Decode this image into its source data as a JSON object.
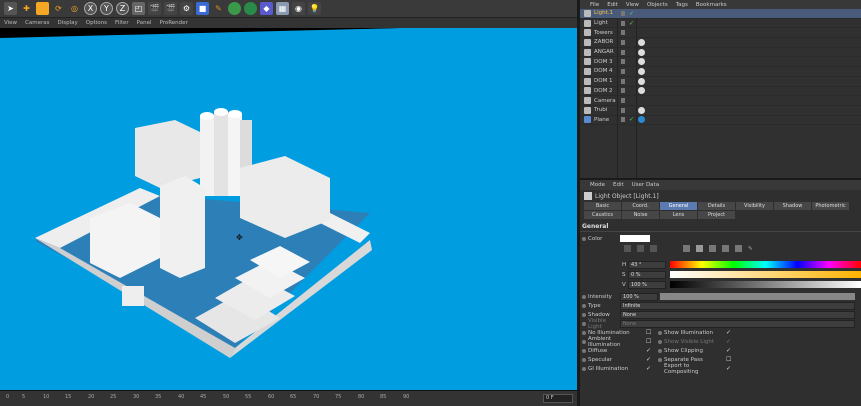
{
  "viewport_menu": [
    "View",
    "Cameras",
    "Display",
    "Options",
    "Filter",
    "Panel",
    "ProRender"
  ],
  "toolbar_icons": [
    "select-icon",
    "move-icon",
    "scale-icon",
    "rotate-icon",
    "recent-icon",
    "x-axis-icon",
    "y-axis-icon",
    "z-axis-icon",
    "world-coord-icon",
    "render-view-icon",
    "render-picture-icon",
    "render-settings-icon",
    "cube-icon",
    "pen-icon",
    "subdivision-icon",
    "array-icon",
    "deformer-icon",
    "floor-icon",
    "camera-icon",
    "light-icon"
  ],
  "toolbar_axis_labels": [
    "X",
    "Y",
    "Z"
  ],
  "timeline": {
    "ticks": [
      "0",
      "5",
      "10",
      "15",
      "20",
      "25",
      "30",
      "35",
      "40",
      "45",
      "50",
      "55",
      "60",
      "65",
      "70",
      "75",
      "80",
      "85",
      "90"
    ],
    "frame": "0 F"
  },
  "object_manager": {
    "menu": [
      "File",
      "Edit",
      "View",
      "Objects",
      "Tags",
      "Bookmarks"
    ],
    "objects": [
      "Light.1",
      "Light",
      "Towers",
      "ZABOR",
      "ANGAR",
      "DOM 3",
      "DOM 4",
      "DOM 1",
      "DOM 2",
      "Camera",
      "Trubi",
      "Plane"
    ]
  },
  "attribute_manager": {
    "menu": [
      "Mode",
      "Edit",
      "User Data"
    ],
    "title": "Light Object [Light.1]",
    "tabs": [
      "Basic",
      "Coord.",
      "General",
      "Details",
      "Visibility",
      "Shadow",
      "Photometric",
      "Caustics",
      "Noise",
      "Lens",
      "Project"
    ],
    "active_tab": "General",
    "section": "General",
    "color_label": "Color",
    "h_label": "H",
    "h_value": "43 °",
    "s_label": "S",
    "s_value": "0 %",
    "v_label": "V",
    "v_value": "100 %",
    "intensity_label": "Intensity",
    "intensity_value": "100 %",
    "type_label": "Type",
    "type_value": "Infinite",
    "shadow_label": "Shadow",
    "shadow_value": "None",
    "visible_light_label": "Visible Light",
    "visible_light_value": "None",
    "left_checks": [
      "No Illumination",
      "Ambient Illumination",
      "Diffuse",
      "Specular",
      "GI Illumination"
    ],
    "right_checks": [
      "Show Illumination",
      "Show Visible Light",
      "Show Clipping",
      "Separate Pass",
      "Export to Compositing"
    ]
  },
  "colors": {
    "viewport_bg": "#009ee0",
    "selected_row": "#4a5a7a"
  }
}
